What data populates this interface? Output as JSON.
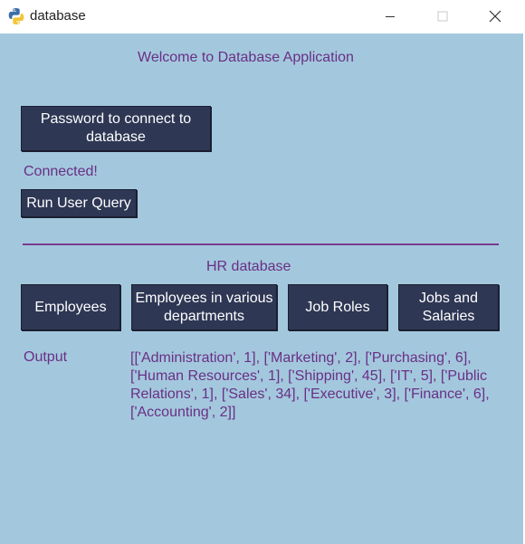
{
  "window": {
    "title": "database",
    "controls": {
      "minimize": "minimize",
      "maximize": "maximize",
      "close": "close"
    }
  },
  "app": {
    "welcome": "Welcome to Database Application",
    "connect_button": "Password to connect to database",
    "status": "Connected!",
    "query_button": "Run User Query",
    "section_title": "HR database",
    "hr_buttons": {
      "employees": "Employees",
      "departments": "Employees in various departments",
      "job_roles": "Job Roles",
      "jobs_salaries": "Jobs and Salaries"
    },
    "output_label": "Output",
    "output_value": "[['Administration', 1], ['Marketing', 2], ['Purchasing', 6], ['Human Resources', 1], ['Shipping', 45], ['IT', 5], ['Public Relations', 1], ['Sales', 34], ['Executive', 3], ['Finance', 6], ['Accounting', 2]]"
  },
  "colors": {
    "background": "#a3c8dd",
    "button": "#2e3754",
    "text": "#6a2f86",
    "separator": "#7a3a8f"
  },
  "icons": {
    "app": "python-icon",
    "minimize": "minimize-icon",
    "maximize": "maximize-icon",
    "close": "close-icon"
  }
}
